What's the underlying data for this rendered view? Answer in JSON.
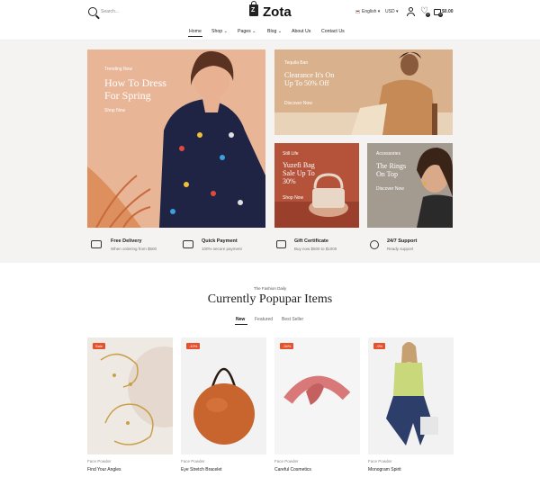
{
  "header": {
    "search_placeholder": "Search...",
    "logo_letter": "Z",
    "logo_text": "Zota",
    "language": "English",
    "currency": "USD",
    "wishlist_count": "0",
    "cart_count": "0",
    "cart_total": "$0.00"
  },
  "nav": {
    "items": [
      {
        "label": "Home",
        "dropdown": false
      },
      {
        "label": "Shop",
        "dropdown": true
      },
      {
        "label": "Pages",
        "dropdown": true
      },
      {
        "label": "Blog",
        "dropdown": true
      },
      {
        "label": "About Us",
        "dropdown": false
      },
      {
        "label": "Contact Us",
        "dropdown": false
      }
    ]
  },
  "hero": {
    "main": {
      "tag": "Trending Now",
      "title_line1": "How To Dress",
      "title_line2": "For Spring",
      "cta": "Shop Now"
    },
    "top_right": {
      "tag": "Tequila Ban",
      "title_line1": "Clearance It's On",
      "title_line2": "Up To 50% Off",
      "cta": "Discover Now"
    },
    "bottom_mid": {
      "tag": "Still Life",
      "title_line1": "Yuzefi Bag",
      "title_line2": "Sale Up To",
      "title_line3": "30%",
      "cta": "Shop Now"
    },
    "bottom_right": {
      "tag": "Accessories",
      "title_line1": "The Rings",
      "title_line2": "On Top",
      "cta": "Discover Now"
    }
  },
  "features": [
    {
      "icon": "truck-icon",
      "title": "Free Delivery",
      "subtitle": "When ordering from $500"
    },
    {
      "icon": "credit-card-icon",
      "title": "Quick Payment",
      "subtitle": "100% secure payment"
    },
    {
      "icon": "gift-icon",
      "title": "Gift Certificate",
      "subtitle": "Buy now $500 to $1000"
    },
    {
      "icon": "support-icon",
      "title": "24/7 Support",
      "subtitle": "Ready support"
    }
  ],
  "section": {
    "subtitle": "The Fashion Daily",
    "title": "Currently Popupar Items",
    "tabs": [
      "New",
      "Featured",
      "Best Seller"
    ]
  },
  "products": [
    {
      "badge": "Sale",
      "category": "Face Powder",
      "name": "Find Your Angles"
    },
    {
      "badge": "-10%",
      "category": "Face Powder",
      "name": "Eye Stretch Bracelet"
    },
    {
      "badge": "-34%",
      "category": "Face Powder",
      "name": "Careful Cosmetics"
    },
    {
      "badge": "-9%",
      "category": "Face Powder",
      "name": "Monogram Spirit"
    }
  ],
  "colors": {
    "accent": "#e4512d",
    "hero_bg": "#f4f3f1"
  }
}
